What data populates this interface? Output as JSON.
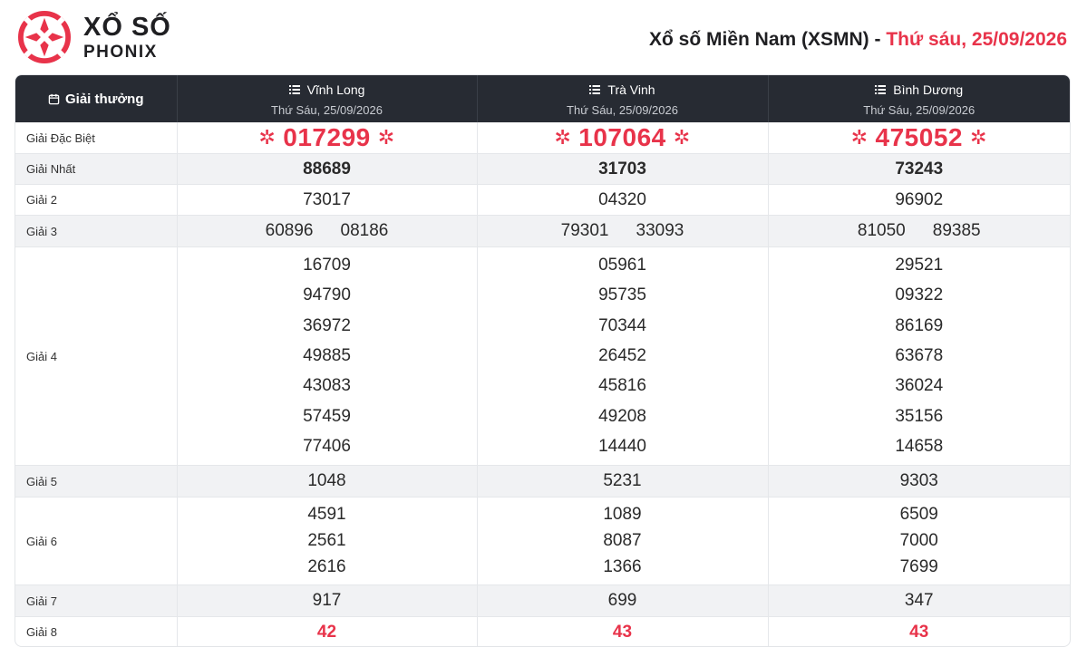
{
  "brand": {
    "line1": "XỔ SỐ",
    "line2": "PHONIX",
    "accent": "#e8334a"
  },
  "page": {
    "title_prefix": "Xổ số Miền Nam (XSMN) - ",
    "title_date": "Thứ sáu, 25/09/2026"
  },
  "table": {
    "prize_header": "Giải thưởng",
    "provinces": [
      {
        "name": "Vĩnh Long",
        "date": "Thứ Sáu, 25/09/2026"
      },
      {
        "name": "Trà Vinh",
        "date": "Thứ Sáu, 25/09/2026"
      },
      {
        "name": "Bình Dương",
        "date": "Thứ Sáu, 25/09/2026"
      }
    ],
    "labels": {
      "db": "Giải Đặc Biệt",
      "n1": "Giải Nhất",
      "g2": "Giải 2",
      "g3": "Giải 3",
      "g4": "Giải 4",
      "g5": "Giải 5",
      "g6": "Giải 6",
      "g7": "Giải 7",
      "g8": "Giải 8"
    },
    "results": [
      {
        "db": "017299",
        "n1": "88689",
        "g2": "73017",
        "g3": [
          "60896",
          "08186"
        ],
        "g4": [
          "16709",
          "94790",
          "36972",
          "49885",
          "43083",
          "57459",
          "77406"
        ],
        "g5": "1048",
        "g6": [
          "4591",
          "2561",
          "2616"
        ],
        "g7": "917",
        "g8": "42"
      },
      {
        "db": "107064",
        "n1": "31703",
        "g2": "04320",
        "g3": [
          "79301",
          "33093"
        ],
        "g4": [
          "05961",
          "95735",
          "70344",
          "26452",
          "45816",
          "49208",
          "14440"
        ],
        "g5": "5231",
        "g6": [
          "1089",
          "8087",
          "1366"
        ],
        "g7": "699",
        "g8": "43"
      },
      {
        "db": "475052",
        "n1": "73243",
        "g2": "96902",
        "g3": [
          "81050",
          "89385"
        ],
        "g4": [
          "29521",
          "09322",
          "86169",
          "63678",
          "36024",
          "35156",
          "14658"
        ],
        "g5": "9303",
        "g6": [
          "6509",
          "7000",
          "7699"
        ],
        "g7": "347",
        "g8": "43"
      }
    ]
  },
  "icons": {
    "logo": "phonix-logo-icon",
    "calendar": "calendar-icon",
    "list": "list-icon",
    "star": "star-icon"
  }
}
